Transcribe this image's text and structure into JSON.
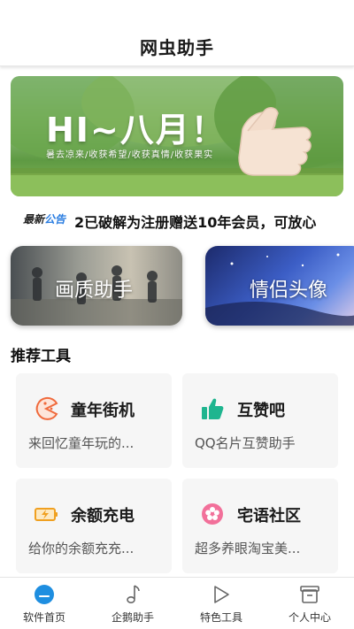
{
  "header": {
    "title": "网虫助手"
  },
  "banner": {
    "headline": "HI~八月！",
    "subtitle": "暑去凉来/收获希望/收获真情/收获果实"
  },
  "notice": {
    "tag_part1": "最新",
    "tag_part2": "公告",
    "text": "2已破解为注册赠送10年会员，可放心"
  },
  "feature_cards": [
    {
      "label": "画质助手"
    },
    {
      "label": "情侣头像"
    }
  ],
  "section": {
    "title": "推荐工具"
  },
  "tools": [
    {
      "name": "童年街机",
      "desc": "来回忆童年玩的...",
      "icon": "pacman-icon",
      "color": "#f06a3c"
    },
    {
      "name": "互赞吧",
      "desc": "QQ名片互赞助手",
      "icon": "thumbs-up-icon",
      "color": "#1fb58f"
    },
    {
      "name": "余额充电",
      "desc": "给你的余额充充...",
      "icon": "battery-charging-icon",
      "color": "#f0a020"
    },
    {
      "name": "宅语社区",
      "desc": "超多养眼淘宝美...",
      "icon": "flower-badge-icon",
      "color": "#f2709a"
    }
  ],
  "tabbar": {
    "items": [
      {
        "label": "软件首页",
        "icon": "home-face-icon",
        "active": true
      },
      {
        "label": "企鹅助手",
        "icon": "music-note-icon",
        "active": false
      },
      {
        "label": "特色工具",
        "icon": "play-triangle-icon",
        "active": false
      },
      {
        "label": "个人中心",
        "icon": "person-box-icon",
        "active": false
      }
    ]
  },
  "colors": {
    "accent": "#1e8ee0",
    "tool_bg": "#f6f6f6"
  }
}
